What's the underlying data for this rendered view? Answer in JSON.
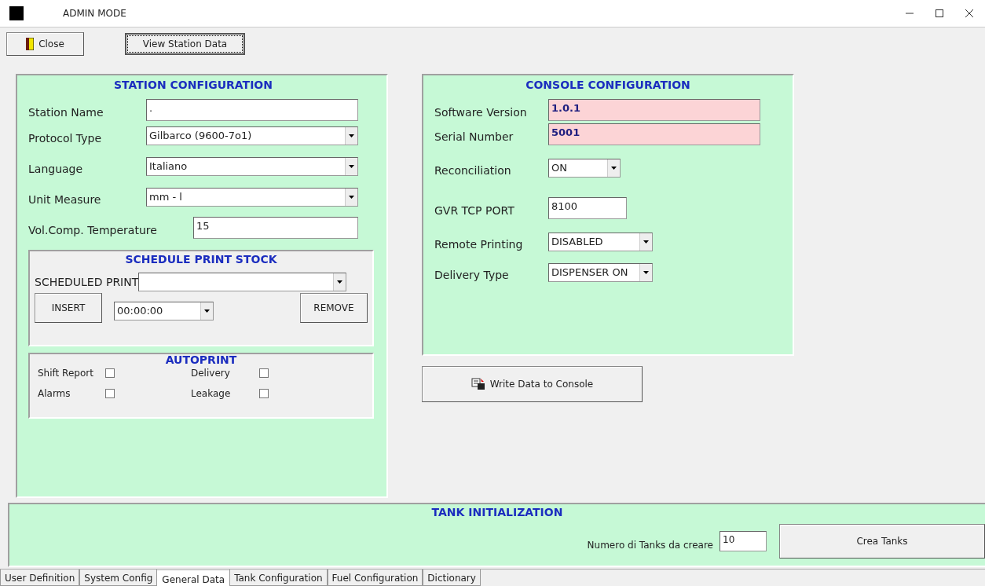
{
  "window": {
    "title": "ADMIN MODE"
  },
  "toolbar": [
    {
      "label": "Close",
      "kind": "close",
      "focused": false
    },
    {
      "label": "View Station Data",
      "kind": "plain",
      "focused": true
    }
  ],
  "station": {
    "title": "STATION CONFIGURATION",
    "fields": [
      {
        "label": "Station Name",
        "kind": "text",
        "value": "."
      },
      {
        "label": "Protocol Type",
        "kind": "select",
        "value": "Gilbarco (9600-7o1)"
      },
      {
        "label": "Language",
        "kind": "select",
        "value": "Italiano"
      },
      {
        "label": "Unit Measure",
        "kind": "select",
        "value": "mm - l"
      },
      {
        "label": "Vol.Comp. Temperature",
        "kind": "text",
        "value": "15"
      }
    ]
  },
  "schedule": {
    "title": "SCHEDULE PRINT STOCK",
    "label": "SCHEDULED PRINT",
    "insert": "INSERT",
    "time": "00:00:00",
    "remove": "REMOVE"
  },
  "autoprint": {
    "title": "AUTOPRINT",
    "items": [
      {
        "label": "Shift Report",
        "checked": false
      },
      {
        "label": "Delivery",
        "checked": false
      },
      {
        "label": "Alarms",
        "checked": false
      },
      {
        "label": "Leakage",
        "checked": false
      }
    ]
  },
  "console": {
    "title": "CONSOLE CONFIGURATION",
    "fields": [
      {
        "label": "Software Version",
        "kind": "readonly",
        "value": "1.0.1"
      },
      {
        "label": "Serial Number",
        "kind": "readonly",
        "value": "5001"
      },
      {
        "label": "Reconciliation",
        "kind": "select",
        "value": "ON"
      },
      {
        "label": "GVR TCP PORT",
        "kind": "text",
        "value": "8100"
      },
      {
        "label": "Remote Printing",
        "kind": "select",
        "value": "DISABLED"
      },
      {
        "label": "Delivery Type",
        "kind": "select",
        "value": "DISPENSER ON"
      }
    ]
  },
  "write_button": {
    "label": "Write Data to Console"
  },
  "tank": {
    "title": "TANK INITIALIZATION",
    "label": "Numero di Tanks da creare",
    "value": "10",
    "button": "Crea Tanks"
  },
  "tabs": [
    {
      "label": "User Definition",
      "selected": false
    },
    {
      "label": "System Config",
      "selected": false
    },
    {
      "label": "General Data",
      "selected": true
    },
    {
      "label": "Tank Configuration",
      "selected": false
    },
    {
      "label": "Fuel Configuration",
      "selected": false
    },
    {
      "label": "Dictionary",
      "selected": false
    }
  ]
}
